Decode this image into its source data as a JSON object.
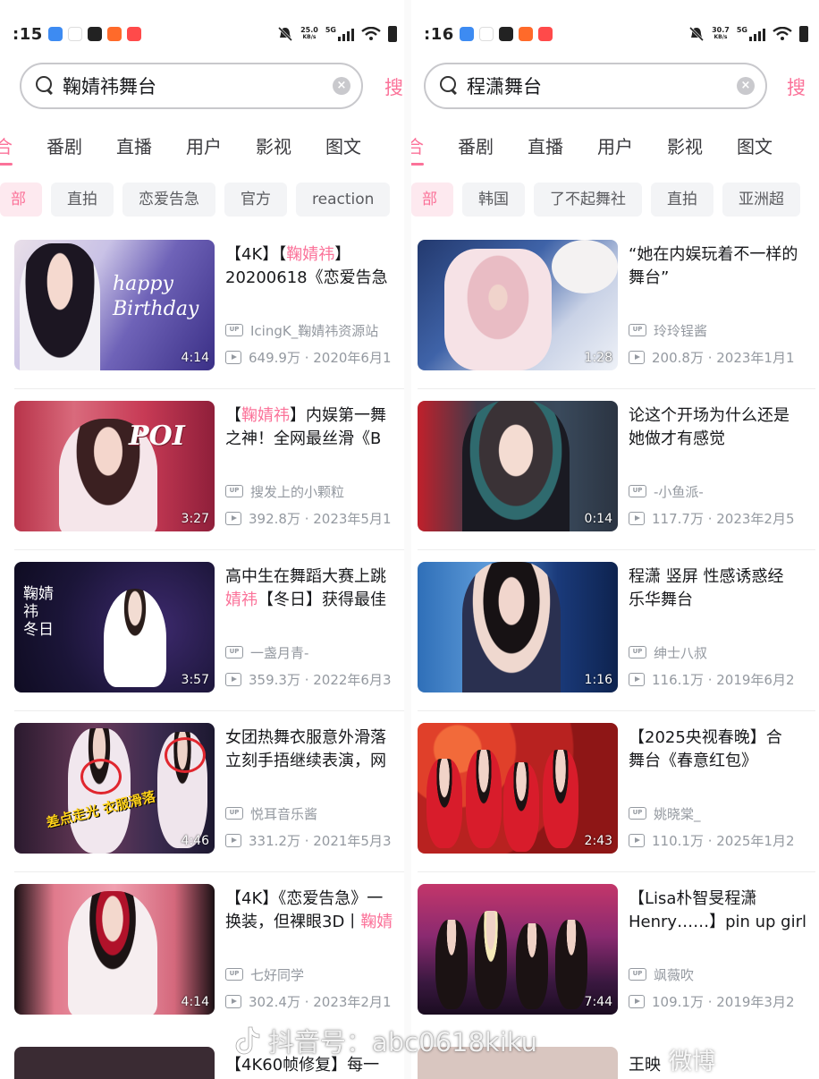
{
  "left": {
    "status": {
      "time": ":15",
      "speed_top": "25.0",
      "speed_bottom": "KB/s",
      "net": "5G"
    },
    "search": {
      "query": "鞠婧祎舞台",
      "button": "搜"
    },
    "tabs": [
      "合",
      "番剧",
      "直播",
      "用户",
      "影视",
      "图文"
    ],
    "chips": [
      "部",
      "直拍",
      "恋爱告急",
      "官方",
      "reaction"
    ],
    "videos": [
      {
        "title_a": "【4K】【",
        "title_hl": "鞠婧祎",
        "title_b": "】",
        "title_line2": "20200618《恋爱告急",
        "uploader": "IcingK_鞠婧祎资源站",
        "stats": "649.9万 · 2020年6月1",
        "duration": "4:14",
        "thumb_text": "happy Birthday"
      },
      {
        "title_a": "【",
        "title_hl": "鞠婧祎",
        "title_b": "】内娱第一舞",
        "title_line2": "之神！全网最丝滑《B",
        "uploader": "搜发上的小颗粒",
        "stats": "392.8万 · 2023年5月1",
        "duration": "3:27",
        "thumb_text": "POI"
      },
      {
        "title_a": "高中生在舞蹈大赛上跳",
        "title_hl": "",
        "title_b": "",
        "title_line2_hl": "婧祎",
        "title_line2": "【冬日】获得最佳",
        "uploader": "一盏月青-",
        "stats": "359.3万 · 2022年6月3",
        "duration": "3:57",
        "thumb_text": "鞠婧祎 冬日"
      },
      {
        "title_a": "女团热舞衣服意外滑落",
        "title_hl": "",
        "title_b": "",
        "title_line2": "立刻手捂继续表演，网",
        "uploader": "悦耳音乐酱",
        "stats": "331.2万 · 2021年5月3",
        "duration": "4:46",
        "thumb_text": "差点走光  衣服滑落"
      },
      {
        "title_a": "【4K】《恋爱告急》一",
        "title_hl": "",
        "title_b": "",
        "title_line2": "换装，但裸眼3D丨",
        "title_line2_tail": "鞠婧",
        "uploader": "七好同学",
        "stats": "302.4万 · 2023年2月1",
        "duration": "4:14",
        "thumb_text": ""
      }
    ],
    "peek_title": "【4K60帧修复】每一"
  },
  "right": {
    "status": {
      "time": ":16",
      "speed_top": "30.7",
      "speed_bottom": "KB/s",
      "net": "5G"
    },
    "search": {
      "query": "程潇舞台",
      "button": "搜"
    },
    "tabs": [
      "合",
      "番剧",
      "直播",
      "用户",
      "影视",
      "图文"
    ],
    "chips": [
      "部",
      "韩国",
      "了不起舞社",
      "直拍",
      "亚洲超"
    ],
    "videos": [
      {
        "title_a": "“她在内娱玩着不一样的",
        "title_line2": "舞台”",
        "uploader": "玲玲锃酱",
        "stats": "200.8万 · 2023年1月1",
        "duration": "1:28"
      },
      {
        "title_a": "论这个开场为什么还是",
        "title_line2": "她做才有感觉",
        "uploader": "-小鱼派-",
        "stats": "117.7万 · 2023年2月5",
        "duration": "0:14"
      },
      {
        "title_a": "程潇 竖屏 性感诱惑经",
        "title_line2": "乐华舞台",
        "uploader": "绅士八叔",
        "stats": "116.1万 · 2019年6月2",
        "duration": "1:16"
      },
      {
        "title_a": "【2025央视春晚】合",
        "title_line2": "舞台《春意红包》",
        "uploader": "姚晓棠_",
        "stats": "110.1万 · 2025年1月2",
        "duration": "2:43"
      },
      {
        "title_a": "【Lisa朴智旻程潇",
        "title_line2": "Henry……】pin up girl",
        "uploader": "飒薇吹",
        "stats": "109.1万 · 2019年3月2",
        "duration": "7:44"
      }
    ],
    "peek_title": "王映"
  },
  "watermark": {
    "text": "抖音号：abc0618kiku",
    "weibo": "微博"
  },
  "colors": {
    "accent": "#fb7299",
    "meta": "#9499a0",
    "chip_bg": "#f3f4f6"
  },
  "icons": [
    "search-icon",
    "clear-icon",
    "mute-icon",
    "signal-icon",
    "wifi-icon",
    "battery-icon",
    "up-badge-icon",
    "play-count-icon",
    "douyin-logo-icon"
  ]
}
